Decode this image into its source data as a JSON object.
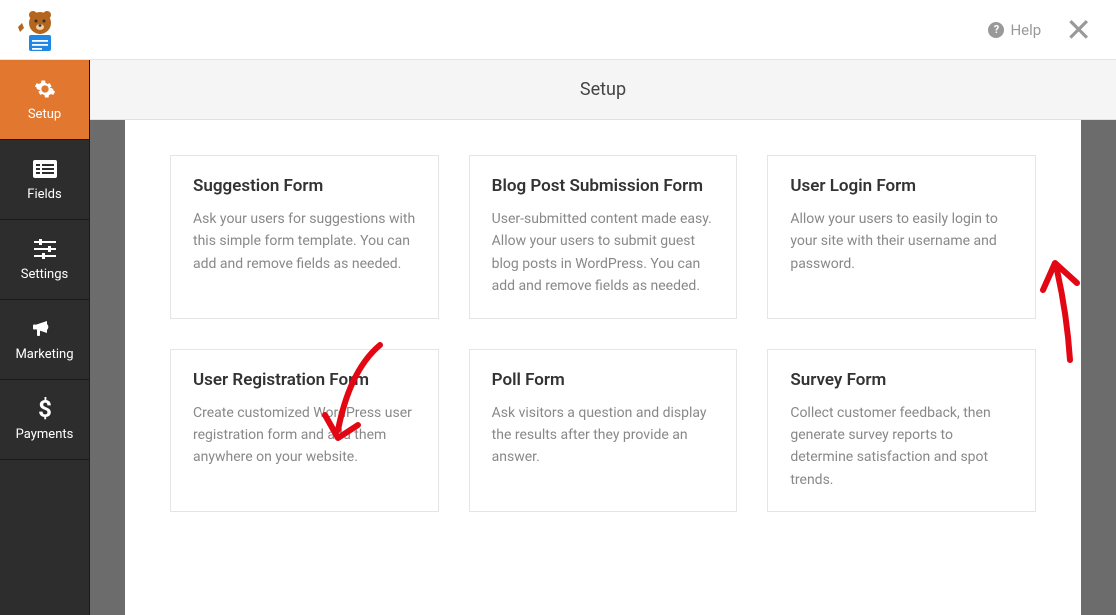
{
  "header": {
    "help_label": "Help"
  },
  "sidebar": {
    "items": [
      {
        "label": "Setup",
        "icon": "gear",
        "active": true
      },
      {
        "label": "Fields",
        "icon": "list",
        "active": false
      },
      {
        "label": "Settings",
        "icon": "sliders",
        "active": false
      },
      {
        "label": "Marketing",
        "icon": "bullhorn",
        "active": false
      },
      {
        "label": "Payments",
        "icon": "dollar",
        "active": false
      }
    ]
  },
  "content": {
    "title": "Setup",
    "templates": [
      {
        "name": "Suggestion Form",
        "description": "Ask your users for suggestions with this simple form template. You can add and remove fields as needed."
      },
      {
        "name": "Blog Post Submission Form",
        "description": "User-submitted content made easy. Allow your users to submit guest blog posts in WordPress. You can add and remove fields as needed."
      },
      {
        "name": "User Login Form",
        "description": "Allow your users to easily login to your site with their username and password."
      },
      {
        "name": "User Registration Form",
        "description": "Create customized WordPress user registration form and add them anywhere on your website."
      },
      {
        "name": "Poll Form",
        "description": "Ask visitors a question and display the results after they provide an answer."
      },
      {
        "name": "Survey Form",
        "description": "Collect customer feedback, then generate survey reports to determine satisfaction and spot trends."
      }
    ]
  }
}
